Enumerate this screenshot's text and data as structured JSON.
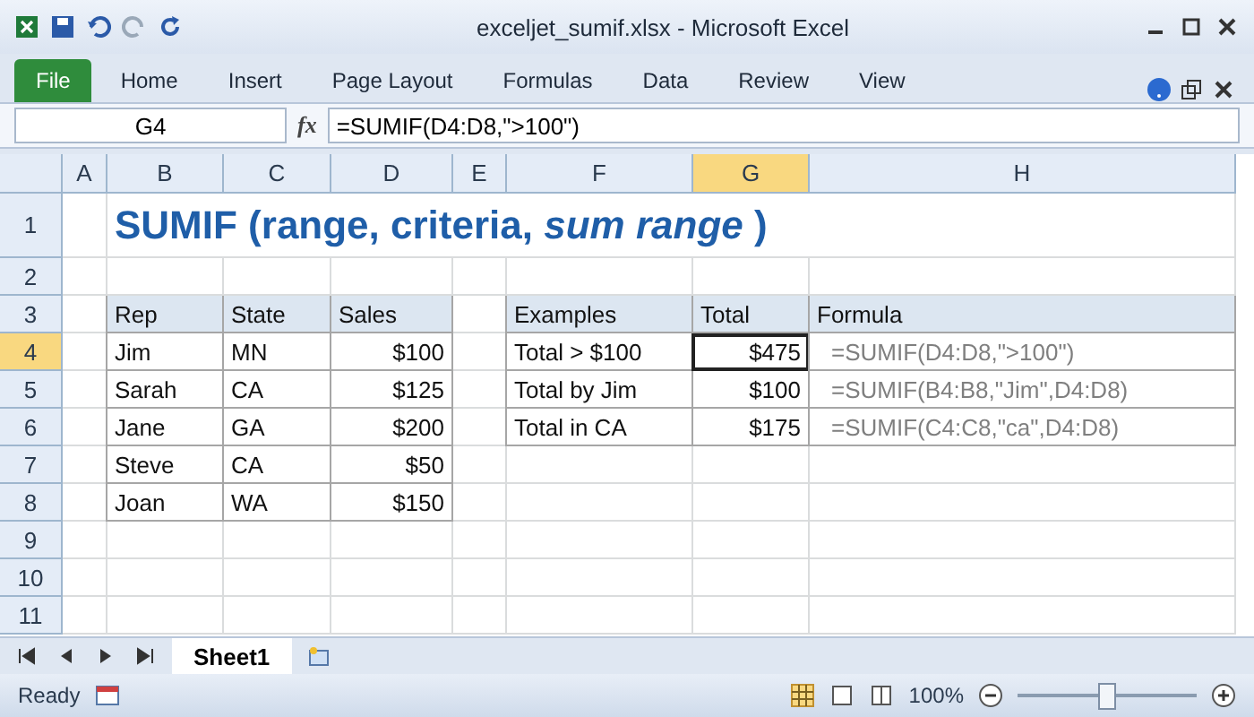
{
  "window": {
    "title": "exceljet_sumif.xlsx  -  Microsoft Excel"
  },
  "ribbon_tabs": [
    {
      "label": "File",
      "kind": "file",
      "selected": false
    },
    {
      "label": "Home",
      "kind": "tab",
      "selected": false
    },
    {
      "label": "Insert",
      "kind": "tab",
      "selected": false
    },
    {
      "label": "Page Layout",
      "kind": "tab",
      "selected": false
    },
    {
      "label": "Formulas",
      "kind": "tab",
      "selected": false
    },
    {
      "label": "Data",
      "kind": "tab",
      "selected": false
    },
    {
      "label": "Review",
      "kind": "tab",
      "selected": false
    },
    {
      "label": "View",
      "kind": "tab",
      "selected": false
    }
  ],
  "formula_bar": {
    "name_box": "G4",
    "fx": "fx",
    "formula": "=SUMIF(D4:D8,\">100\")"
  },
  "columns": [
    {
      "label": "A",
      "selected": false
    },
    {
      "label": "B",
      "selected": false
    },
    {
      "label": "C",
      "selected": false
    },
    {
      "label": "D",
      "selected": false
    },
    {
      "label": "E",
      "selected": false
    },
    {
      "label": "F",
      "selected": false
    },
    {
      "label": "G",
      "selected": true
    },
    {
      "label": "H",
      "selected": false
    }
  ],
  "row_headers": [
    {
      "label": "1",
      "selected": false
    },
    {
      "label": "2",
      "selected": false
    },
    {
      "label": "3",
      "selected": false
    },
    {
      "label": "4",
      "selected": true
    },
    {
      "label": "5",
      "selected": false
    },
    {
      "label": "6",
      "selected": false
    },
    {
      "label": "7",
      "selected": false
    },
    {
      "label": "8",
      "selected": false
    },
    {
      "label": "9",
      "selected": false
    },
    {
      "label": "10",
      "selected": false
    },
    {
      "label": "11",
      "selected": false
    }
  ],
  "sheet_title": "SUMIF (range, criteria, *sum range* )",
  "sales_table": {
    "columns": [
      "Rep",
      "State",
      "Sales"
    ],
    "rows": [
      [
        "Jim",
        "MN",
        "$100"
      ],
      [
        "Sarah",
        "CA",
        "$125"
      ],
      [
        "Jane",
        "GA",
        "$200"
      ],
      [
        "Steve",
        "CA",
        "$50"
      ],
      [
        "Joan",
        "WA",
        "$150"
      ]
    ]
  },
  "examples_table": {
    "columns": [
      "Examples",
      "Total",
      "Formula"
    ],
    "rows": [
      {
        "example": "Total > $100",
        "total": "$475",
        "formula": "=SUMIF(D4:D8,\">100\")",
        "selected": true
      },
      {
        "example": "Total by Jim",
        "total": "$100",
        "formula": "=SUMIF(B4:B8,\"Jim\",D4:D8)",
        "selected": false
      },
      {
        "example": "Total in CA",
        "total": "$175",
        "formula": "=SUMIF(C4:C8,\"ca\",D4:D8)",
        "selected": false
      }
    ]
  },
  "sheet_tabs": [
    {
      "label": "Sheet1",
      "selected": true
    }
  ],
  "status_bar": {
    "status": "Ready",
    "zoom": "100%",
    "zoom_level": {
      "level": 0.5
    }
  }
}
